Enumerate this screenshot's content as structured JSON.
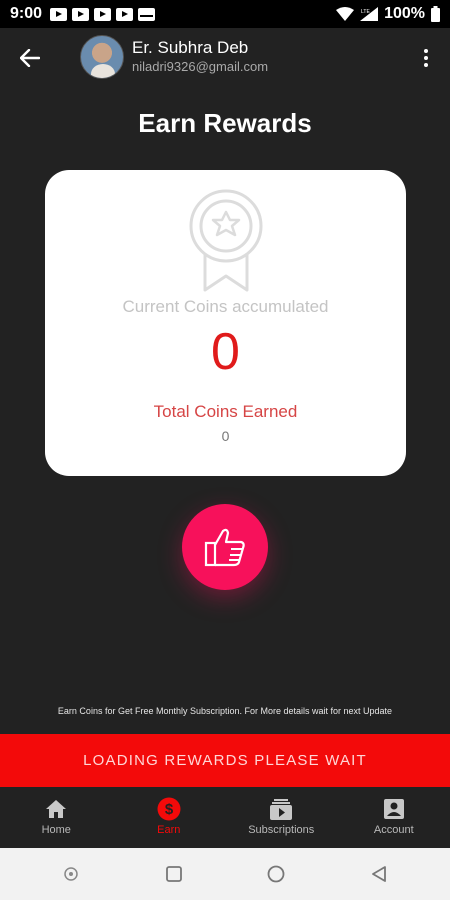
{
  "status_bar": {
    "time": "9:00",
    "battery": "100%",
    "network": "LTE"
  },
  "user": {
    "name": "Er. Subhra Deb",
    "email": "niladri9326@gmail.com"
  },
  "page_title": "Earn Rewards",
  "card": {
    "coins_label": "Current Coins accumulated",
    "coins_value": "0",
    "total_label": "Total Coins Earned",
    "total_value": "0"
  },
  "info_text": "Earn Coins for Get Free Monthly Subscription. For More details wait for next Update",
  "loading_text": "LOADING REWARDS PLEASE WAIT",
  "nav": {
    "items": [
      {
        "label": "Home",
        "icon": "home-icon"
      },
      {
        "label": "Earn",
        "icon": "dollar-icon"
      },
      {
        "label": "Subscriptions",
        "icon": "subscriptions-icon"
      },
      {
        "label": "Account",
        "icon": "account-icon"
      }
    ],
    "active": "Earn"
  },
  "colors": {
    "accent_red": "#f30a0a",
    "like_pink": "#f7115b",
    "background": "#222222"
  }
}
